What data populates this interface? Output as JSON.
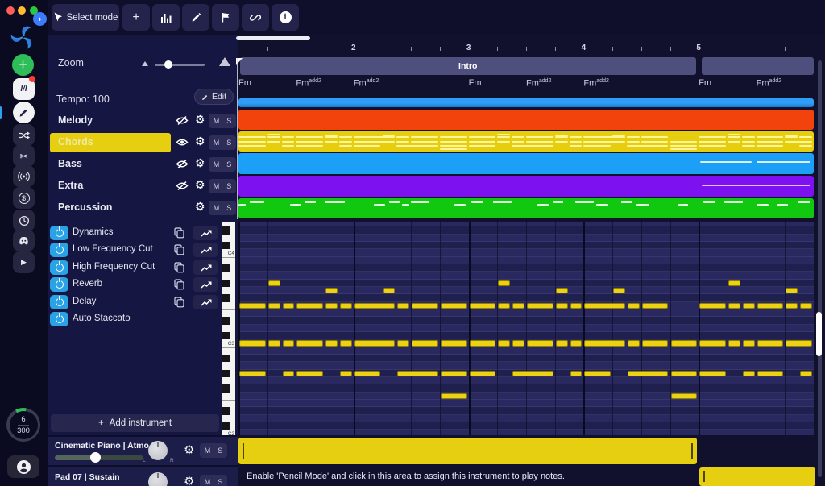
{
  "titlebar": {
    "traffic_lights": [
      "#ff5f57",
      "#febc2e",
      "#28c840"
    ]
  },
  "sidebar": {
    "expand_icon": "›",
    "versions_glyph": "l/l",
    "icon_names": [
      "versions-icon",
      "pencil-icon",
      "shuffle-icon",
      "scissors-icon",
      "broadcast-icon",
      "dollar-icon",
      "clock-icon",
      "discord-icon",
      "play-icon"
    ],
    "quota_used": "6",
    "quota_total": "300"
  },
  "glyphs": {
    "plus": "+",
    "caret": "▾",
    "gear": "⚙",
    "scissors": "✂",
    "play": "▶",
    "dollar": "$",
    "info_i": "i",
    "ms_m": "M",
    "ms_s": "S"
  },
  "toolbar": {
    "select_mode": "Select mode",
    "icons": [
      "add-icon",
      "bar-chart-icon",
      "pencil-icon",
      "flag-icon",
      "link-icon",
      "info-icon"
    ]
  },
  "controls": {
    "zoom_label": "Zoom",
    "tempo_label": "Tempo:",
    "tempo_value": "100",
    "edit_label": "Edit"
  },
  "tracks": [
    {
      "name": "Melody",
      "eye": "hidden",
      "selected": false
    },
    {
      "name": "Chords",
      "eye": "visible",
      "selected": true
    },
    {
      "name": "Bass",
      "eye": "hidden",
      "selected": false
    },
    {
      "name": "Extra",
      "eye": "hidden",
      "selected": false
    },
    {
      "name": "Percussion",
      "eye": "none",
      "selected": false
    }
  ],
  "track_buttons": {
    "mute": "M",
    "solo": "S"
  },
  "effects": [
    {
      "name": "Dynamics",
      "copy": true,
      "curve": true
    },
    {
      "name": "Low Frequency Cut",
      "copy": true,
      "curve": true
    },
    {
      "name": "High Frequency Cut",
      "copy": true,
      "curve": true
    },
    {
      "name": "Reverb",
      "copy": true,
      "curve": true
    },
    {
      "name": "Delay",
      "copy": true,
      "curve": true
    },
    {
      "name": "Auto Staccato",
      "copy": false,
      "curve": false
    }
  ],
  "add_instrument_label": "Add instrument",
  "instruments": [
    {
      "name": "Cinematic Piano | Atmo...",
      "pan_l": "L",
      "pan_r": "R",
      "volume_pct": 52
    },
    {
      "name": "Pad 07 | Sustain"
    }
  ],
  "timeline": {
    "measure_numbers": [
      {
        "label": "2",
        "measure": 2
      },
      {
        "label": "3",
        "measure": 3
      },
      {
        "label": "4",
        "measure": 4
      },
      {
        "label": "5",
        "measure": 5
      }
    ],
    "sections": [
      {
        "label": "Intro",
        "start_beat": 0.05,
        "end_beat": 15.9
      },
      {
        "label": "",
        "start_beat": 16.1,
        "end_beat": 20.0
      }
    ],
    "chords": [
      {
        "root": "Fm",
        "sup": "",
        "beat": 0
      },
      {
        "root": "Fm",
        "sup": "add2",
        "beat": 2
      },
      {
        "root": "Fm",
        "sup": "add2",
        "beat": 4
      },
      {
        "root": "Fm",
        "sup": "",
        "beat": 8
      },
      {
        "root": "Fm",
        "sup": "add2",
        "beat": 10
      },
      {
        "root": "Fm",
        "sup": "add2",
        "beat": 12
      },
      {
        "root": "Fm",
        "sup": "",
        "beat": 16
      },
      {
        "root": "Fm",
        "sup": "add2",
        "beat": 18
      }
    ]
  },
  "arrangement_bars": [
    {
      "track": "overview",
      "color": "#2f9ef6"
    },
    {
      "track": "Melody",
      "color": "#f2430d"
    },
    {
      "track": "Chords",
      "color": "#e6cd0e"
    },
    {
      "track": "Bass",
      "color": "#1b9ff7"
    },
    {
      "track": "Extra",
      "color": "#7d11ef"
    },
    {
      "track": "Percussion",
      "color": "#12c70f"
    }
  ],
  "piano_labels": [
    {
      "label": "C4",
      "midi": 60
    },
    {
      "label": "C3",
      "midi": 48
    },
    {
      "label": "C2",
      "midi": 36
    }
  ],
  "notes": {
    "chords_track": [
      {
        "midi": 56,
        "segs": [
          [
            1,
            0.5
          ],
          [
            9,
            0.5
          ],
          [
            17,
            0.5
          ]
        ]
      },
      {
        "midi": 55,
        "segs": [
          [
            3,
            0.5
          ],
          [
            5,
            0.5
          ],
          [
            11,
            0.5
          ],
          [
            13,
            0.5
          ],
          [
            19,
            0.5
          ]
        ]
      },
      {
        "midi": 53,
        "segs": [
          [
            0,
            1
          ],
          [
            1,
            0.5
          ],
          [
            1.5,
            0.5
          ],
          [
            2,
            1
          ],
          [
            3,
            0.5
          ],
          [
            3.5,
            0.5
          ],
          [
            4,
            1.5
          ],
          [
            5.5,
            0.5
          ],
          [
            6,
            1
          ],
          [
            7,
            1
          ],
          [
            8,
            1
          ],
          [
            9,
            0.5
          ],
          [
            9.5,
            0.5
          ],
          [
            10,
            1
          ],
          [
            11,
            0.5
          ],
          [
            11.5,
            0.5
          ],
          [
            12,
            1.5
          ],
          [
            13.5,
            0.5
          ],
          [
            14,
            1
          ],
          [
            16,
            1
          ],
          [
            17,
            0.5
          ],
          [
            17.5,
            0.5
          ],
          [
            18,
            1
          ],
          [
            19,
            0.5
          ],
          [
            19.5,
            0.5
          ]
        ]
      },
      {
        "midi": 48,
        "segs": [
          [
            0,
            1
          ],
          [
            1,
            0.5
          ],
          [
            1.5,
            0.5
          ],
          [
            2,
            1
          ],
          [
            3,
            0.5
          ],
          [
            3.5,
            0.5
          ],
          [
            4,
            1.5
          ],
          [
            5.5,
            0.5
          ],
          [
            6,
            1
          ],
          [
            7,
            1
          ],
          [
            8,
            1
          ],
          [
            9,
            0.5
          ],
          [
            9.5,
            0.5
          ],
          [
            10,
            1
          ],
          [
            11,
            0.5
          ],
          [
            11.5,
            0.5
          ],
          [
            12,
            1.5
          ],
          [
            13.5,
            0.5
          ],
          [
            14,
            1
          ],
          [
            15,
            1
          ],
          [
            16,
            1
          ],
          [
            17,
            0.5
          ],
          [
            17.5,
            0.5
          ],
          [
            18,
            1
          ],
          [
            19,
            1
          ]
        ]
      },
      {
        "midi": 44,
        "segs": [
          [
            0,
            1
          ],
          [
            1.5,
            0.5
          ],
          [
            2,
            1
          ],
          [
            3.5,
            0.5
          ],
          [
            4,
            1
          ],
          [
            5.5,
            1.5
          ],
          [
            7,
            1
          ],
          [
            8,
            1
          ],
          [
            9.5,
            1.5
          ],
          [
            11.5,
            0.5
          ],
          [
            12,
            1
          ],
          [
            13.5,
            1.5
          ],
          [
            15,
            1
          ],
          [
            16,
            1
          ],
          [
            17.5,
            0.5
          ],
          [
            18,
            1
          ],
          [
            19.5,
            0.5
          ]
        ]
      },
      {
        "midi": 41,
        "segs": [
          [
            7,
            1
          ],
          [
            15,
            1
          ]
        ]
      }
    ],
    "bass_preview": [
      [
        16.05,
        1.85
      ],
      [
        18.0,
        1.95
      ]
    ],
    "extra_preview": [
      [
        16.1,
        3.85
      ]
    ],
    "percussion_preview": [
      {
        "level": 0,
        "segs": [
          [
            0.4,
            0.55
          ],
          [
            2.3,
            0.45
          ],
          [
            3.0,
            0.75
          ],
          [
            5.25,
            0.4
          ],
          [
            6.0,
            0.7
          ],
          [
            8.1,
            0.45
          ],
          [
            8.85,
            0.7
          ],
          [
            10.95,
            0.4
          ],
          [
            11.7,
            0.7
          ],
          [
            13.3,
            0.45
          ],
          [
            16.15,
            0.5
          ],
          [
            16.9,
            0.7
          ],
          [
            19.45,
            0.5
          ]
        ]
      },
      {
        "level": 1,
        "segs": [
          [
            0,
            0.3
          ],
          [
            1.8,
            0.45
          ],
          [
            4.7,
            0.45
          ],
          [
            5.7,
            0.3
          ],
          [
            7.5,
            0.45
          ],
          [
            10.4,
            0.45
          ],
          [
            12.45,
            0.45
          ],
          [
            13.85,
            0.5
          ],
          [
            15.3,
            0.4
          ],
          [
            18.0,
            0.5
          ],
          [
            18.75,
            0.4
          ]
        ]
      }
    ]
  },
  "regions": [
    {
      "lane": 0,
      "start_beat": 0,
      "end_beat": 15.95
    },
    {
      "lane": 1,
      "start_beat": 16.03,
      "end_beat": 20.05
    }
  ],
  "hint": "Enable 'Pencil Mode' and click in this area to assign this instrument to play notes.",
  "colors": {
    "selection_yellow": "#e6cf11",
    "note_yellow": "#edd214",
    "effect_power_blue": "#2aa2e6",
    "section_gray": "#4f4f7d"
  }
}
